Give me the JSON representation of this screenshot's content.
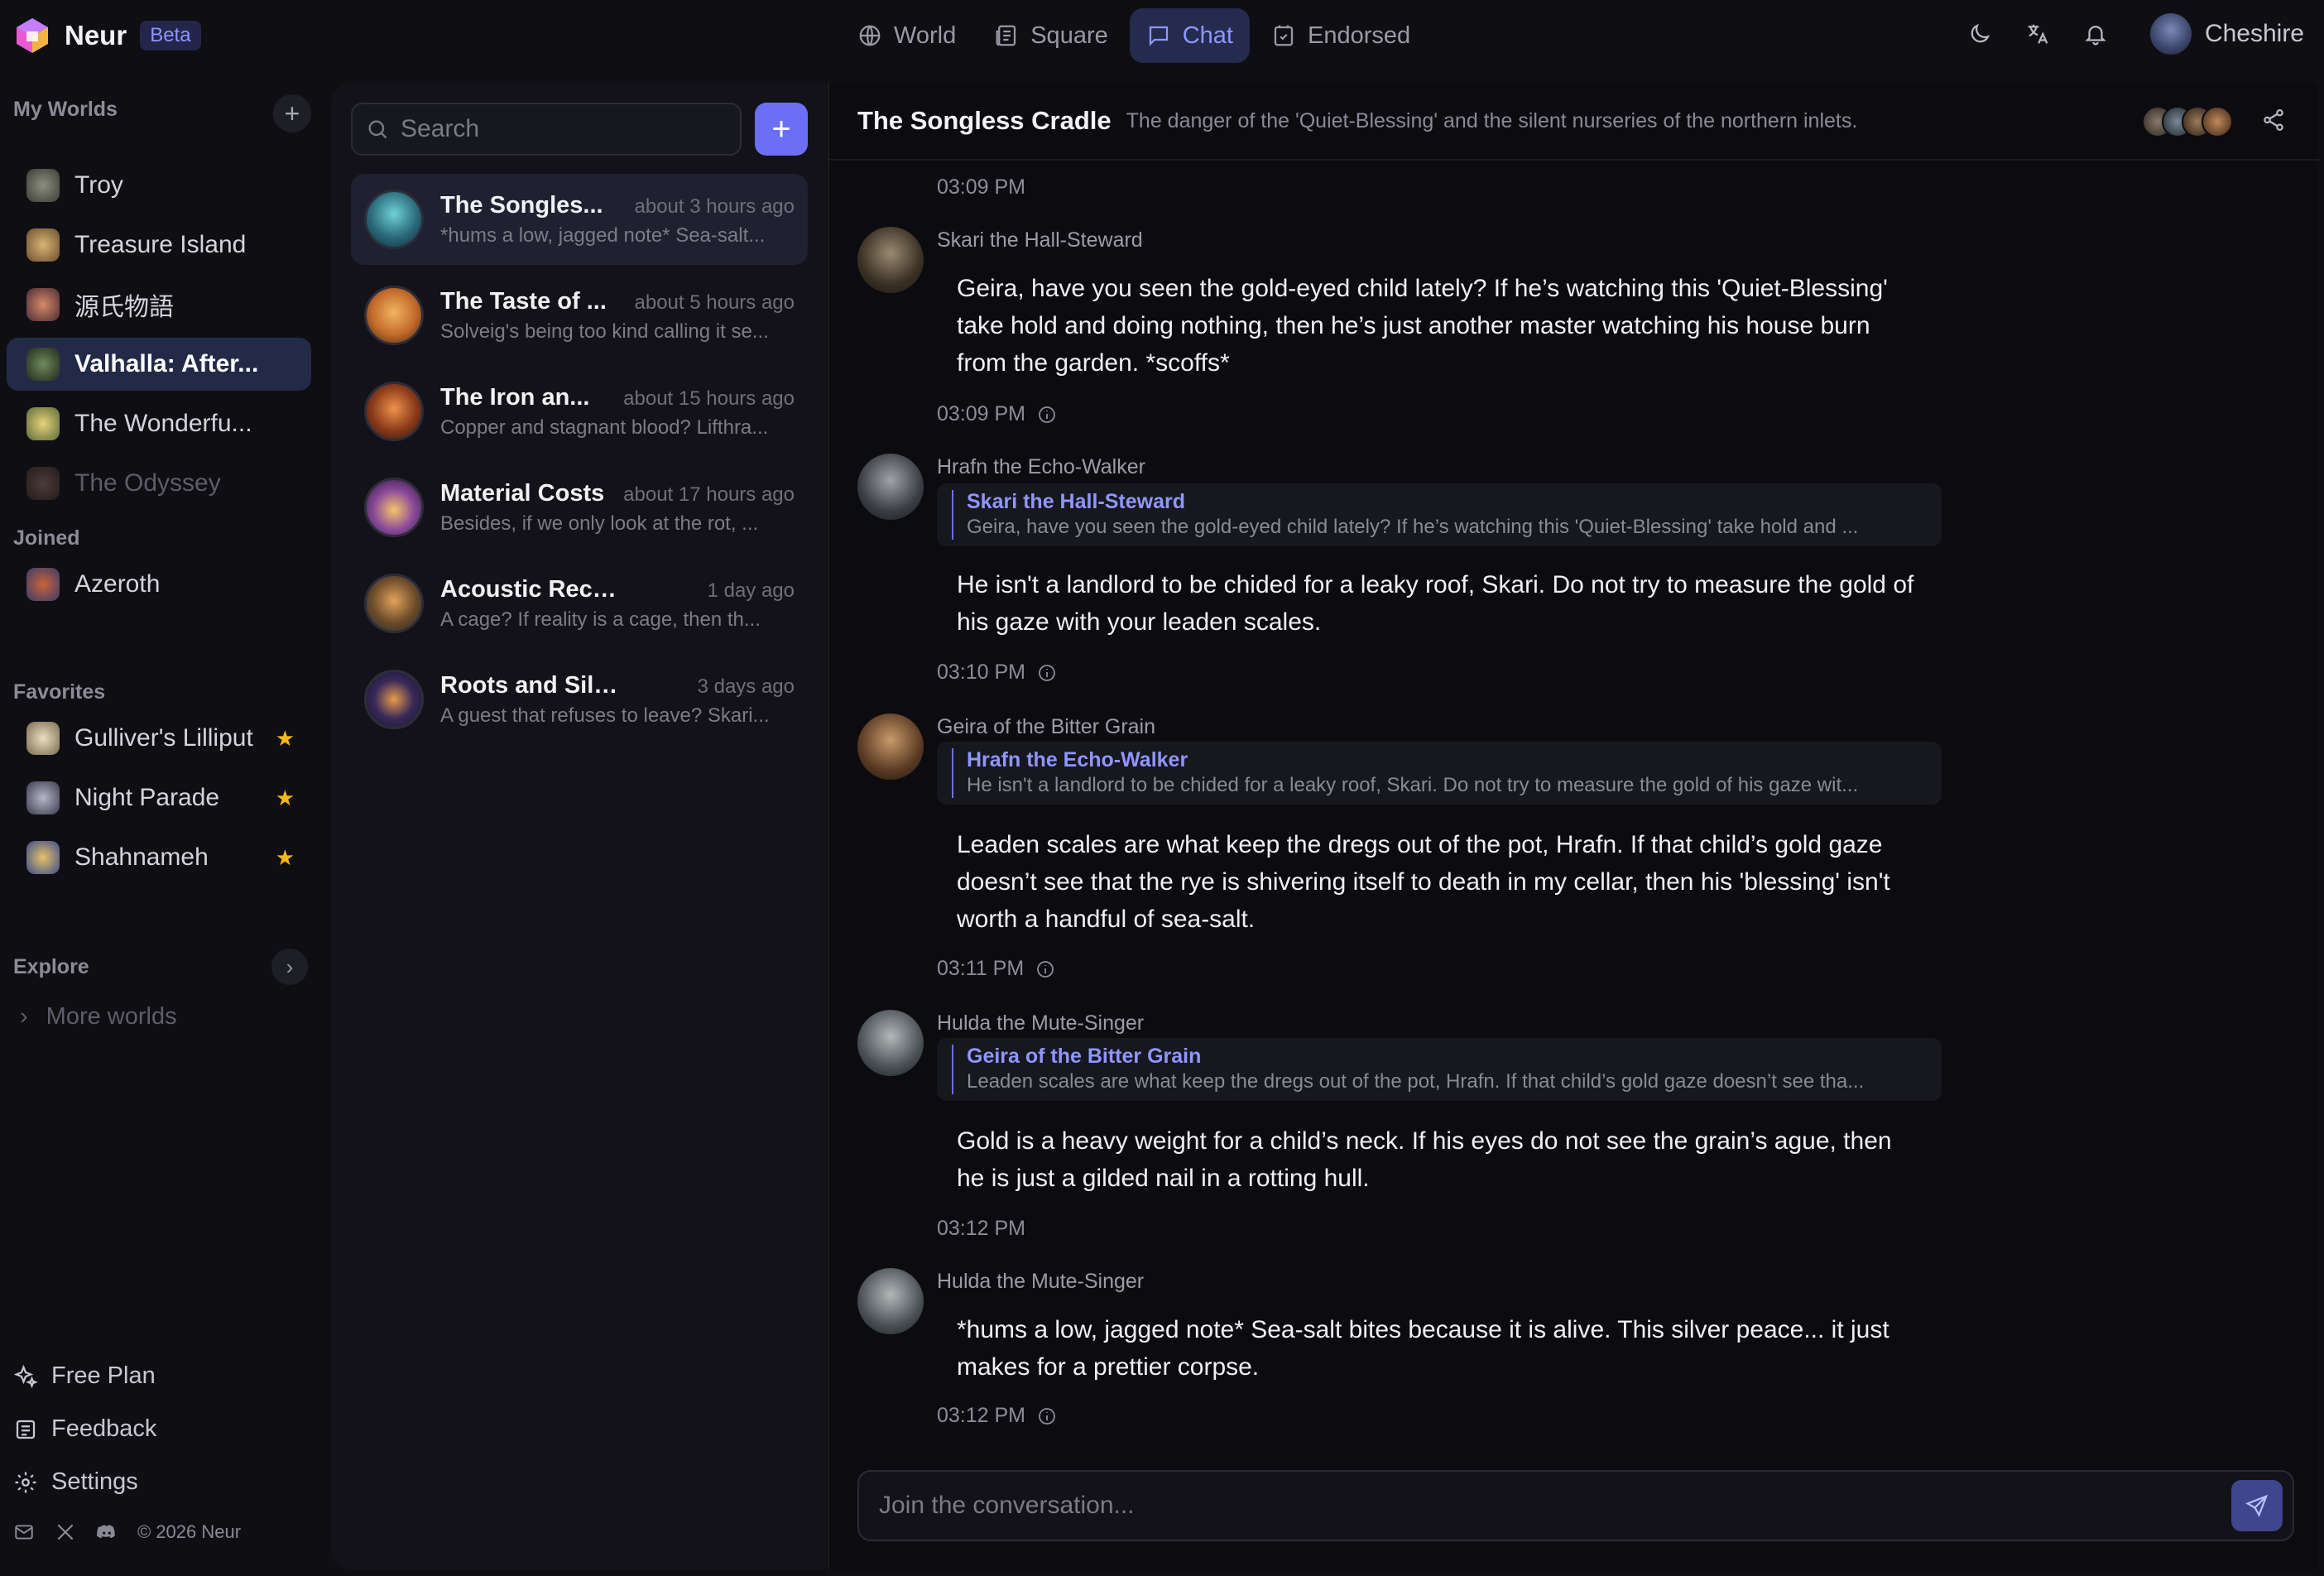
{
  "brand": {
    "name": "Neur",
    "badge": "Beta"
  },
  "nav": {
    "tabs": [
      {
        "label": "World",
        "icon": "globe-icon"
      },
      {
        "label": "Square",
        "icon": "newspaper-icon"
      },
      {
        "label": "Chat",
        "icon": "chat-icon",
        "active": true
      },
      {
        "label": "Endorsed",
        "icon": "bookmark-check-icon"
      }
    ]
  },
  "user": {
    "name": "Cheshire"
  },
  "sidebar": {
    "my_worlds_title": "My Worlds",
    "my_worlds": [
      {
        "label": "Troy"
      },
      {
        "label": "Treasure Island"
      },
      {
        "label": "源氏物語"
      },
      {
        "label": "Valhalla: After...",
        "active": true
      },
      {
        "label": "The Wonderfu..."
      },
      {
        "label": "The Odyssey",
        "faded": true
      }
    ],
    "joined_title": "Joined",
    "joined": [
      {
        "label": "Azeroth"
      }
    ],
    "favorites_title": "Favorites",
    "favorites": [
      {
        "label": "Gulliver's Lilliput"
      },
      {
        "label": "Night Parade"
      },
      {
        "label": "Shahnameh"
      }
    ],
    "explore_title": "Explore",
    "more_worlds": "More worlds",
    "footer": {
      "free_plan": "Free Plan",
      "feedback": "Feedback",
      "settings": "Settings",
      "copyright": "© 2026 Neur"
    }
  },
  "chat_list": {
    "search_placeholder": "Search",
    "items": [
      {
        "title": "The Songles...",
        "time": "about 3 hours ago",
        "preview": "*hums a low, jagged note* Sea-salt...",
        "active": true
      },
      {
        "title": "The Taste of ...",
        "time": "about 5 hours ago",
        "preview": "Solveig's being too kind calling it se..."
      },
      {
        "title": "The Iron an...",
        "time": "about 15 hours ago",
        "preview": "Copper and stagnant blood? Lifthra..."
      },
      {
        "title": "Material Costs",
        "time": "about 17 hours ago",
        "preview": "Besides, if we only look at the rot, ..."
      },
      {
        "title": "Acoustic Records",
        "time": "1 day ago",
        "preview": "A cage? If reality is a cage, then th..."
      },
      {
        "title": "Roots and Silence",
        "time": "3 days ago",
        "preview": "A guest that refuses to leave? Skari..."
      }
    ]
  },
  "conversation": {
    "title": "The Songless Cradle",
    "description": "The danger of the 'Quiet-Blessing' and the silent nurseries of the northern inlets.",
    "top_time": "03:09 PM",
    "messages": [
      {
        "author": "Skari the Hall-Steward",
        "text": "Geira, have you seen the gold-eyed child lately? If he’s watching this 'Quiet-Blessing' take hold and doing nothing, then he’s just another master watching his house burn from the garden. *scoffs*",
        "time": "03:09 PM"
      },
      {
        "author": "Hrafn the Echo-Walker",
        "reply_to": "Skari the Hall-Steward",
        "reply_text": "Geira, have you seen the gold-eyed child lately? If he’s watching this 'Quiet-Blessing' take hold and ...",
        "text": "He isn't a landlord to be chided for a leaky roof, Skari. Do not try to measure the gold of his gaze with your leaden scales.",
        "time": "03:10 PM"
      },
      {
        "author": "Geira of the Bitter Grain",
        "reply_to": "Hrafn the Echo-Walker",
        "reply_text": "He isn't a landlord to be chided for a leaky roof, Skari. Do not try to measure the gold of his gaze wit...",
        "text": "Leaden scales are what keep the dregs out of the pot, Hrafn. If that child’s gold gaze doesn’t see that the rye is shivering itself to death in my cellar, then his 'blessing' isn't worth a handful of sea-salt.",
        "time": "03:11 PM"
      },
      {
        "author": "Hulda the Mute-Singer",
        "reply_to": "Geira of the Bitter Grain",
        "reply_text": "Leaden scales are what keep the dregs out of the pot, Hrafn. If that child’s gold gaze doesn’t see tha...",
        "text": "Gold is a heavy weight for a child’s neck. If his eyes do not see the grain’s ague, then he is just a gilded nail in a rotting hull.",
        "time": "03:12 PM"
      },
      {
        "author": "Hulda the Mute-Singer",
        "text": "*hums a low, jagged note* Sea-salt bites because it is alive. This silver peace... it just makes for a prettier corpse.",
        "time": "03:12 PM"
      }
    ],
    "composer_placeholder": "Join the conversation..."
  },
  "colors": {
    "accent": "#6b6ff6",
    "star": "#f5b81c",
    "active_nav_bg": "#252a4f"
  }
}
